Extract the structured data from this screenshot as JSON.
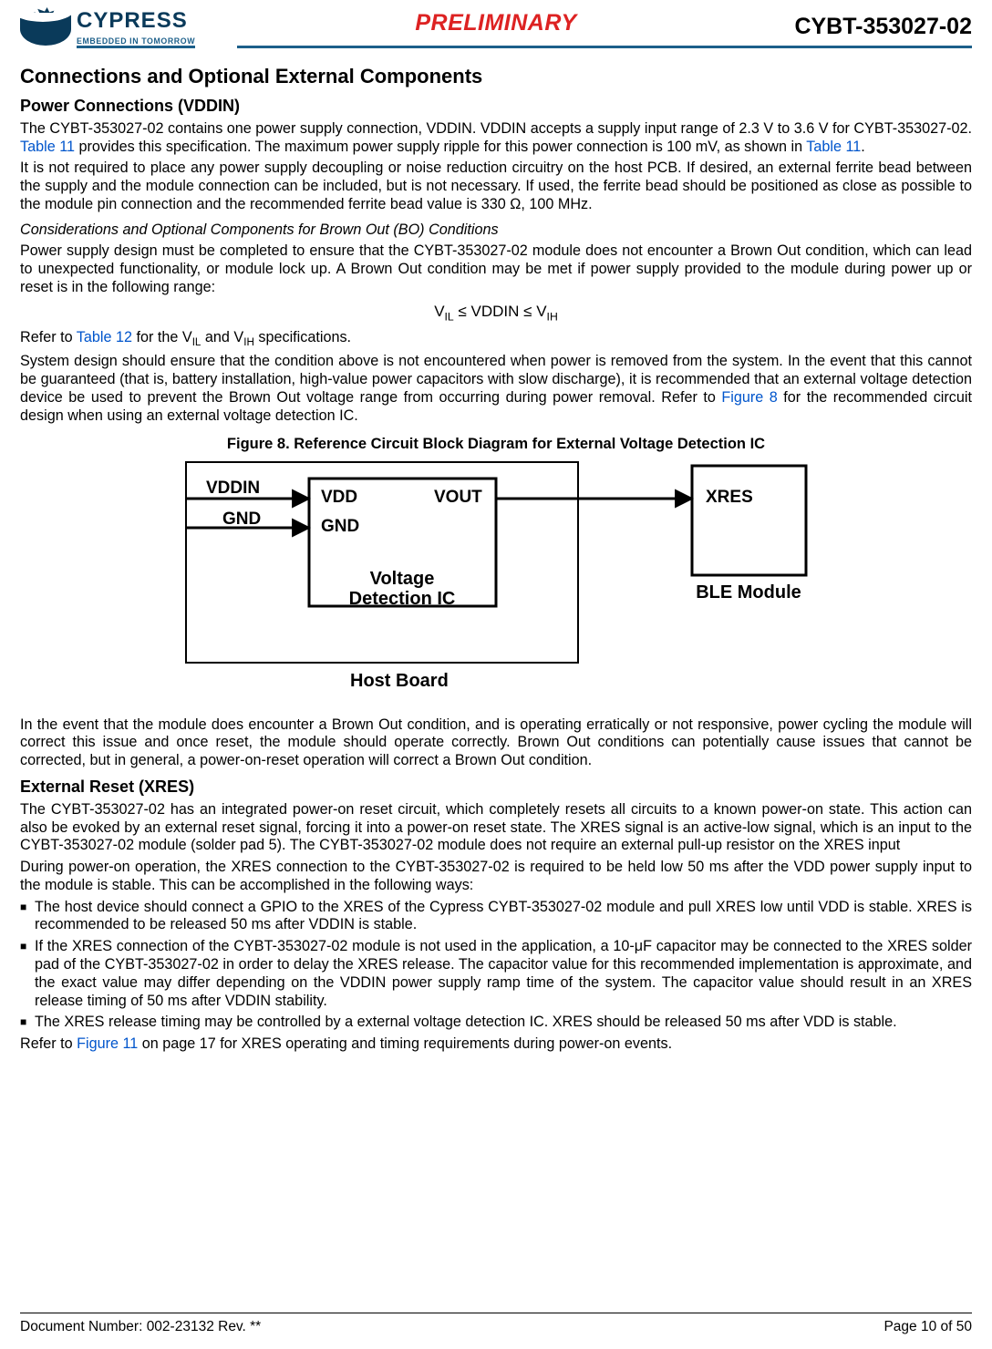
{
  "header": {
    "logo_name": "CYPRESS",
    "logo_tagline": "EMBEDDED IN TOMORROW",
    "preliminary": "PRELIMINARY",
    "part_number": "CYBT-353027-02"
  },
  "h1": "Connections and Optional External Components",
  "h2_power": "Power Connections (VDDIN)",
  "p1a": "The CYBT-353027-02 contains one power supply connection, VDDIN. VDDIN accepts a supply input range of 2.3 V to 3.6 V for CYBT-353027-02. ",
  "p1_link1": "Table 11",
  "p1b": " provides this specification. The maximum power supply ripple for this power connection is 100 mV, as shown in ",
  "p1_link2": "Table 11",
  "p1c": ".",
  "p2": "It is not required to place any power supply decoupling or noise reduction circuitry on the host PCB. If desired, an external ferrite bead between the supply and the module connection can be included, but is not necessary. If used, the ferrite bead should be positioned as close as possible to the module pin connection and the recommended ferrite bead value is 330 Ω, 100 MHz.",
  "h3_bo": "Considerations and Optional Components for Brown Out (BO) Conditions",
  "p3": "Power supply design must be completed to ensure that the CYBT-353027-02 module does not encounter a Brown Out condition, which can lead to unexpected functionality, or module lock up. A Brown Out condition may be met if power supply provided to the module during power up or reset is in the following range:",
  "eq_pre": "V",
  "eq_sub1": "IL",
  "eq_mid": " ≤ VDDIN ≤ V",
  "eq_sub2": "IH",
  "p4a": "Refer to ",
  "p4_link": "Table 12",
  "p4b": " for the V",
  "p4_sub1": "IL",
  "p4c": " and V",
  "p4_sub2": "IH",
  "p4d": " specifications.",
  "p5a": "System design should ensure that the condition above is not encountered when power is removed from the system. In the event that this cannot be guaranteed (that is, battery installation, high-value power capacitors with slow discharge), it is recommended that an external voltage detection device be used to prevent the Brown Out voltage range from occurring during power removal. Refer to ",
  "p5_link": "Figure 8",
  "p5b": " for the recommended circuit design when using an external voltage detection IC.",
  "fig_title": "Figure 8.  Reference Circuit Block Diagram for External Voltage Detection IC",
  "fig": {
    "vddin": "VDDIN",
    "gnd_left": "GND",
    "vdd": "VDD",
    "gnd_mid": "GND",
    "vout": "VOUT",
    "block_label_1": "Voltage",
    "block_label_2": "Detection IC",
    "xres": "XRES",
    "ble_module": "BLE Module",
    "host_board": "Host Board"
  },
  "p6": "In the event that the module does encounter a Brown Out condition, and is operating erratically or not responsive, power cycling the module will correct this issue and once reset, the module should operate correctly. Brown Out conditions can potentially cause issues that cannot be corrected, but in general, a power-on-reset operation will correct a Brown Out condition.",
  "h2_xres": "External Reset (XRES)",
  "p7": "The CYBT-353027-02 has an integrated power-on reset circuit, which completely resets all circuits to a known power-on state. This action can also be evoked by an external reset signal, forcing it into a power-on reset state. The XRES signal is an active-low signal, which is an input to the CYBT-353027-02 module (solder pad 5). The CYBT-353027-02 module does not require an external pull-up resistor on the XRES input",
  "p8": "During power-on operation, the XRES connection to the CYBT-353027-02 is required to be held low 50 ms after the VDD power supply input to the module is stable. This can be accomplished in the following ways:",
  "bullets": [
    "The host device should connect a GPIO to the XRES of the Cypress CYBT-353027-02 module and pull XRES low until VDD is stable. XRES is recommended to be released 50 ms after VDDIN is stable.",
    "If the XRES connection of the CYBT-353027-02 module is not used in the application, a 10-μF capacitor may be connected to the XRES solder pad of the CYBT-353027-02 in order to delay the XRES release. The capacitor value for this recommended implementation is approximate, and the exact value may differ depending on the VDDIN power supply ramp time of the system. The capacitor value should result in an XRES release timing of 50 ms after VDDIN stability.",
    "The XRES release timing may be controlled by a external voltage detection IC. XRES should be released 50 ms after VDD is stable."
  ],
  "p9a": "Refer to ",
  "p9_link": "Figure 11",
  "p9b": " on page 17 for XRES operating and timing requirements during power-on events.",
  "footer": {
    "doc": "Document Number: 002-23132 Rev. **",
    "page": "Page 10 of 50"
  }
}
